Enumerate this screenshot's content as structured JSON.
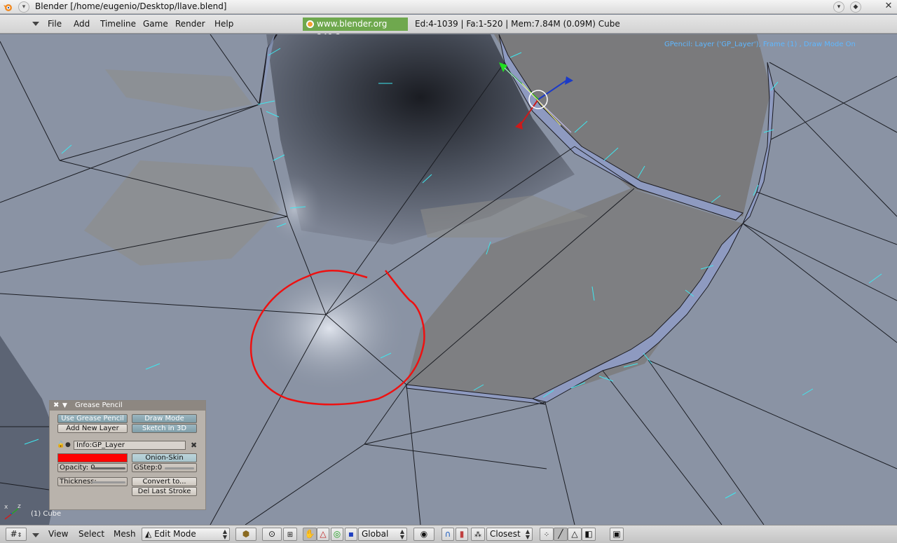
{
  "window": {
    "title": "Blender [/home/eugenio/Desktop/llave.blend]"
  },
  "menubar": {
    "items": [
      "File",
      "Add",
      "Timeline",
      "Game",
      "Render",
      "Help"
    ],
    "blender_link": "www.blender.org 249.2",
    "stats": "Ed:4-1039 | Fa:1-520 | Mem:7.84M (0.09M) Cube"
  },
  "viewport": {
    "gpencil_info": "GPencil: Layer ('GP_Layer'), Frame (1) , Draw Mode On",
    "object_label": "(1) Cube",
    "axis_labels": {
      "x": "x",
      "z": "z"
    }
  },
  "grease_pencil_panel": {
    "title": "Grease Pencil",
    "use_grease_pencil": "Use Grease Pencil",
    "draw_mode": "Draw Mode",
    "add_new_layer": "Add New Layer",
    "sketch_in_3d": "Sketch in 3D",
    "layer_name": "Info:GP_Layer",
    "stroke_color": "#ff0000",
    "onion_skin": "Onion-Skin",
    "opacity_label": "Opacity: 0",
    "gstep_label": "GStep:0",
    "thickness_label": "Thickness:",
    "convert_to": "Convert to...",
    "del_last_stroke": "Del Last Stroke"
  },
  "bottombar": {
    "menus": [
      "View",
      "Select",
      "Mesh"
    ],
    "mode": "Edit Mode",
    "orientation": "Global",
    "snap_target": "Closest"
  }
}
